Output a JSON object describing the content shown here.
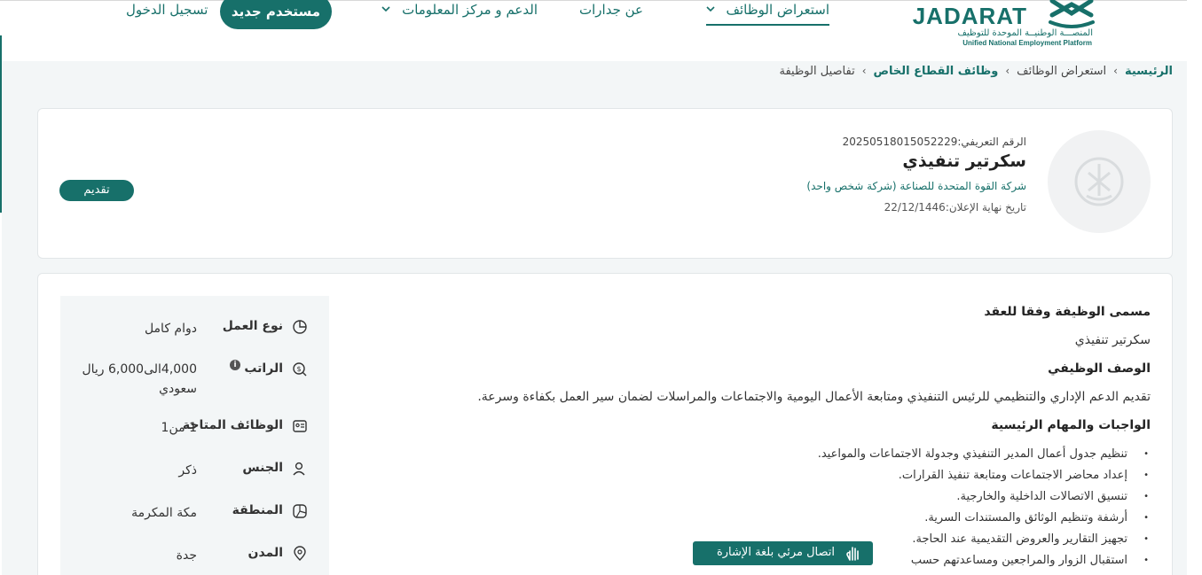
{
  "header": {
    "logo": {
      "word": "JADARAT",
      "sub_ar": "المنصـــة الوطنيــة الموحدة للتوظيف",
      "sub_en": "Unified National Employment Platform"
    },
    "nav": {
      "browse_jobs": "استعراض الوظائف",
      "about": "عن جدارات",
      "support": "الدعم و مركز المعلومات",
      "new_user": "مستخدم جديد",
      "login": "تسجيل الدخول"
    }
  },
  "breadcrumb": {
    "home": "الرئيسية",
    "browse": "استعراض الوظائف",
    "private": "وظائف القطاع الخاص",
    "current": "تفاصيل الوظيفة"
  },
  "job": {
    "id_line": "الرقم التعريفي:20250518015052229",
    "title": "سكرتير تنفيذي",
    "company": "شركة القوة المتحدة للصناعة (شركة شخص واحد)",
    "deadline": "تاريخ نهاية الإعلان:22/12/1446",
    "apply_label": "تقديم"
  },
  "details": {
    "contract_title_heading": "مسمى الوظيفة وفقا للعقد",
    "contract_title": "سكرتير تنفيذي",
    "description_heading": "الوصف الوظيفي",
    "description": "تقديم الدعم الإداري والتنظيمي للرئيس التنفيذي ومتابعة الأعمال اليومية والاجتماعات والمراسلات لضمان سير العمل بكفاءة وسرعة.",
    "duties_heading": "الواجبات والمهام الرئيسية",
    "duties": [
      "تنظيم جدول أعمال المدير التنفيذي وجدولة الاجتماعات والمواعيد.",
      "إعداد محاضر الاجتماعات ومتابعة تنفيذ القرارات.",
      "تنسيق الاتصالات الداخلية والخارجية.",
      "أرشفة وتنظيم الوثائق والمستندات السرية.",
      "تجهيز التقارير والعروض التقديمية عند الحاجة.",
      "استقبال الزوار والمراجعين ومساعدتهم حسب"
    ]
  },
  "sidebar": {
    "work_type": {
      "label": "نوع العمل",
      "value": "دوام كامل"
    },
    "salary": {
      "label": "الراتب",
      "value": "4,000الى6,000 ريال سعودي",
      "info": "i"
    },
    "available": {
      "label": "الوظائف المتاحة",
      "value": "1 من1"
    },
    "gender": {
      "label": "الجنس",
      "value": "ذكر"
    },
    "region": {
      "label": "المنطقة",
      "value": "مكة المكرمة"
    },
    "city": {
      "label": "المدن",
      "value": "جدة"
    }
  },
  "sign_language": {
    "label": "اتصال مرئي بلغة الإشارة"
  },
  "colors": {
    "brand": "#17706a",
    "background": "#f3f6f7"
  }
}
